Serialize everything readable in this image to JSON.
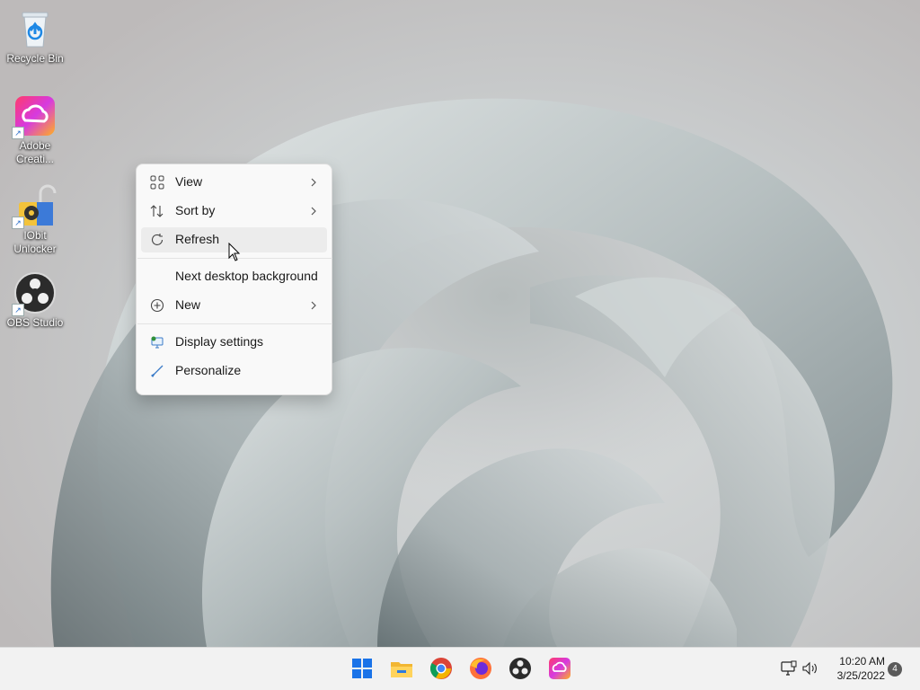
{
  "desktop": {
    "icons": [
      {
        "label": "Recycle Bin",
        "icon": "recycle-bin-icon"
      },
      {
        "label": "Adobe Creati...",
        "icon": "adobe-creative-cloud-icon"
      },
      {
        "label": "IObit Unlocker",
        "icon": "iobit-unlocker-icon"
      },
      {
        "label": "OBS Studio",
        "icon": "obs-studio-icon"
      }
    ]
  },
  "context_menu": {
    "items": [
      {
        "label": "View",
        "icon": "view-grid-icon",
        "submenu": true
      },
      {
        "label": "Sort by",
        "icon": "sort-icon",
        "submenu": true
      },
      {
        "label": "Refresh",
        "icon": "refresh-icon",
        "submenu": false,
        "hovered": true
      },
      {
        "label": "Next desktop background",
        "icon": "",
        "submenu": false
      },
      {
        "label": "New",
        "icon": "new-plus-icon",
        "submenu": true
      },
      {
        "label": "Display settings",
        "icon": "display-settings-icon",
        "submenu": false
      },
      {
        "label": "Personalize",
        "icon": "personalize-brush-icon",
        "submenu": false
      }
    ]
  },
  "taskbar": {
    "apps": [
      "start-windows-icon",
      "file-explorer-icon",
      "chrome-icon",
      "firefox-icon",
      "obs-studio-icon",
      "adobe-creative-cloud-icon"
    ],
    "tray": [
      "network-icon",
      "volume-icon"
    ],
    "time": "10:20 AM",
    "date": "3/25/2022",
    "notification_count": "4"
  },
  "colors": {
    "menu_bg": "#f9f9f9",
    "hover_bg": "#ececec",
    "taskbar_bg": "#f2f2f2",
    "windows_blue": "#1a73e8"
  }
}
